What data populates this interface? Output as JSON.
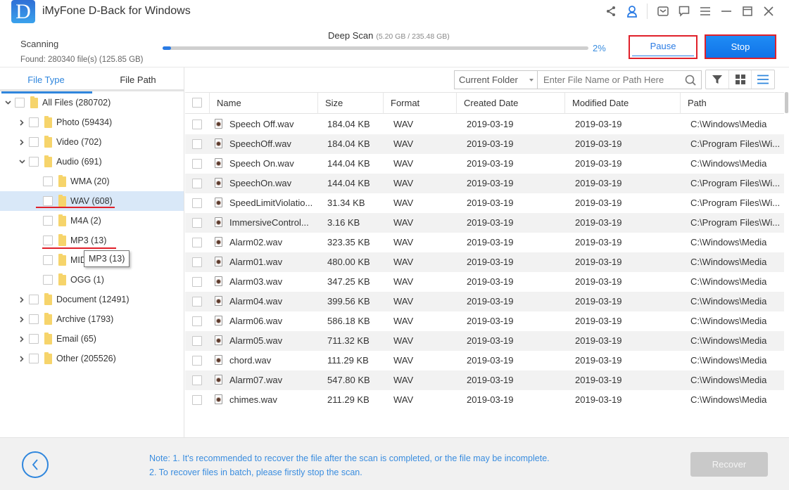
{
  "app": {
    "title": "iMyFone D-Back for Windows",
    "logo_letter": "D"
  },
  "titlebar_icons": [
    "share-icon",
    "account-icon",
    "mail-icon",
    "feedback-icon",
    "menu-icon",
    "minimize-icon",
    "maximize-icon",
    "close-icon"
  ],
  "scan": {
    "status": "Scanning",
    "found": "Found: 280340 file(s) (125.85 GB)",
    "mode": "Deep Scan",
    "progress_detail": "(5.20 GB / 235.48 GB)",
    "progress_percent": 2,
    "progress_label": "2%",
    "pause_label": "Pause",
    "stop_label": "Stop"
  },
  "left_tabs": [
    {
      "label": "File Type",
      "active": true
    },
    {
      "label": "File Path",
      "active": false
    }
  ],
  "tree": [
    {
      "label": "All Files (280702)",
      "level": 0,
      "expander": "expanded"
    },
    {
      "label": "Photo (59434)",
      "level": 1,
      "expander": "collapsed"
    },
    {
      "label": "Video (702)",
      "level": 1,
      "expander": "collapsed"
    },
    {
      "label": "Audio (691)",
      "level": 1,
      "expander": "expanded"
    },
    {
      "label": "WMA (20)",
      "level": 2,
      "expander": "none"
    },
    {
      "label": "WAV (608)",
      "level": 2,
      "expander": "none",
      "selected": true
    },
    {
      "label": "M4A (2)",
      "level": 2,
      "expander": "none"
    },
    {
      "label": "MP3 (13)",
      "level": 2,
      "expander": "none"
    },
    {
      "label": "MIDI",
      "level": 2,
      "expander": "none"
    },
    {
      "label": "OGG (1)",
      "level": 2,
      "expander": "none"
    },
    {
      "label": "Document (12491)",
      "level": 1,
      "expander": "collapsed"
    },
    {
      "label": "Archive (1793)",
      "level": 1,
      "expander": "collapsed"
    },
    {
      "label": "Email (65)",
      "level": 1,
      "expander": "collapsed"
    },
    {
      "label": "Other (205526)",
      "level": 1,
      "expander": "collapsed"
    }
  ],
  "tooltip": "MP3 (13)",
  "toolbar": {
    "folder_scope": "Current Folder",
    "search_placeholder": "Enter File Name or Path Here",
    "search_value": "",
    "view_buttons": [
      "filter-icon",
      "grid-view-icon",
      "list-view-icon"
    ],
    "active_view": "list-view-icon"
  },
  "table": {
    "columns": [
      "Name",
      "Size",
      "Format",
      "Created Date",
      "Modified Date",
      "Path"
    ],
    "rows": [
      [
        "Speech Off.wav",
        "184.04 KB",
        "WAV",
        "2019-03-19",
        "2019-03-19",
        "C:\\Windows\\Media"
      ],
      [
        "SpeechOff.wav",
        "184.04 KB",
        "WAV",
        "2019-03-19",
        "2019-03-19",
        "C:\\Program Files\\Wi..."
      ],
      [
        "Speech On.wav",
        "144.04 KB",
        "WAV",
        "2019-03-19",
        "2019-03-19",
        "C:\\Windows\\Media"
      ],
      [
        "SpeechOn.wav",
        "144.04 KB",
        "WAV",
        "2019-03-19",
        "2019-03-19",
        "C:\\Program Files\\Wi..."
      ],
      [
        "SpeedLimitViolatio...",
        "31.34 KB",
        "WAV",
        "2019-03-19",
        "2019-03-19",
        "C:\\Program Files\\Wi..."
      ],
      [
        "ImmersiveControl...",
        "3.16 KB",
        "WAV",
        "2019-03-19",
        "2019-03-19",
        "C:\\Program Files\\Wi..."
      ],
      [
        "Alarm02.wav",
        "323.35 KB",
        "WAV",
        "2019-03-19",
        "2019-03-19",
        "C:\\Windows\\Media"
      ],
      [
        "Alarm01.wav",
        "480.00 KB",
        "WAV",
        "2019-03-19",
        "2019-03-19",
        "C:\\Windows\\Media"
      ],
      [
        "Alarm03.wav",
        "347.25 KB",
        "WAV",
        "2019-03-19",
        "2019-03-19",
        "C:\\Windows\\Media"
      ],
      [
        "Alarm04.wav",
        "399.56 KB",
        "WAV",
        "2019-03-19",
        "2019-03-19",
        "C:\\Windows\\Media"
      ],
      [
        "Alarm06.wav",
        "586.18 KB",
        "WAV",
        "2019-03-19",
        "2019-03-19",
        "C:\\Windows\\Media"
      ],
      [
        "Alarm05.wav",
        "711.32 KB",
        "WAV",
        "2019-03-19",
        "2019-03-19",
        "C:\\Windows\\Media"
      ],
      [
        "chord.wav",
        "111.29 KB",
        "WAV",
        "2019-03-19",
        "2019-03-19",
        "C:\\Windows\\Media"
      ],
      [
        "Alarm07.wav",
        "547.80 KB",
        "WAV",
        "2019-03-19",
        "2019-03-19",
        "C:\\Windows\\Media"
      ],
      [
        "chimes.wav",
        "211.29 KB",
        "WAV",
        "2019-03-19",
        "2019-03-19",
        "C:\\Windows\\Media"
      ]
    ]
  },
  "footer": {
    "note_line1": "Note: 1. It's recommended to recover the file after the scan is completed, or the file may be incomplete.",
    "note_line2": "2. To recover files in batch, please firstly stop the scan.",
    "recover_label": "Recover",
    "recover_enabled": false
  },
  "colors": {
    "accent": "#2f86dd",
    "stop_button": "#1173e8",
    "annotation_red": "#e0202a",
    "folder": "#f6d46b",
    "selected_row": "#d9e8f8"
  }
}
